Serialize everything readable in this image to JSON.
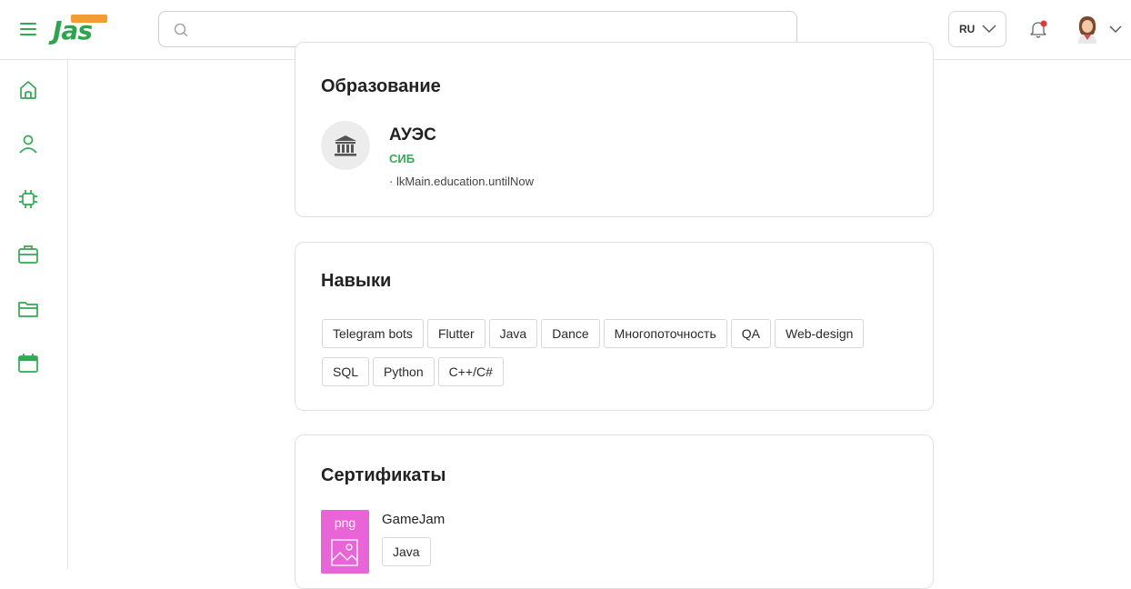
{
  "header": {
    "logo_text": "Jas",
    "search": {
      "placeholder": "",
      "value": ""
    },
    "language": "RU"
  },
  "colors": {
    "brand_green": "#34a853",
    "notification_dot": "#e53935",
    "cert_thumb": "#e964d6"
  },
  "sidebar": {
    "items": [
      {
        "icon": "home-icon"
      },
      {
        "icon": "user-icon"
      },
      {
        "icon": "chip-icon"
      },
      {
        "icon": "briefcase-icon"
      },
      {
        "icon": "folder-icon"
      },
      {
        "icon": "calendar-icon"
      }
    ]
  },
  "education": {
    "title": "Образование",
    "institution": "АУЭС",
    "specialty": "СИБ",
    "period": "· lkMain.education.untilNow"
  },
  "skills": {
    "title": "Навыки",
    "items": [
      "Telegram bots",
      "Flutter",
      "Java",
      "Dance",
      "Многопоточность",
      "QA",
      "Web-design",
      "SQL",
      "Python",
      "C++/C#"
    ]
  },
  "certificates": {
    "title": "Сертификаты",
    "items": [
      {
        "ext": "png",
        "name": "GameJam",
        "tag": "Java"
      }
    ]
  }
}
